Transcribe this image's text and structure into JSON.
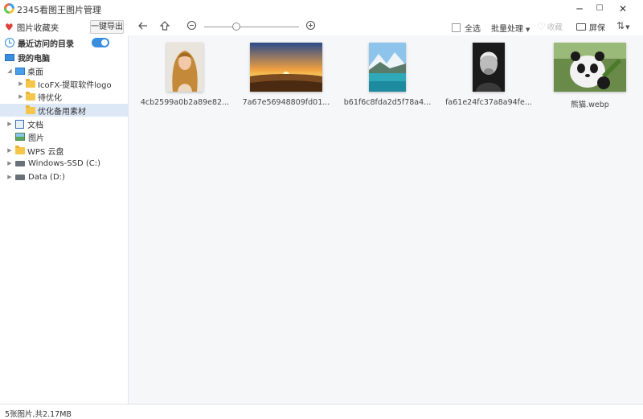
{
  "app": {
    "title": "2345看图王图片管理",
    "window_controls": [
      "─",
      "☐",
      "✕"
    ]
  },
  "toolbar": {
    "favorites_label": "图片收藏夹",
    "export_label": "一键导出",
    "select_all_label": "全选",
    "batch_label": "批量处理",
    "collect_label": "收藏",
    "screen_label": "屏保"
  },
  "sidebar": {
    "recent_label": "最近访问的目录",
    "recent_toggle_on": true,
    "my_pc_label": "我的电脑",
    "desktop_label": "桌面",
    "folders": [
      "IcoFX-提取软件logo",
      "待优化",
      "优化备用素材"
    ],
    "documents_label": "文档",
    "pictures_label": "图片",
    "wps_label": "WPS 云盘",
    "drive_c_label": "Windows-SSD (C:)",
    "drive_d_label": "Data (D:)"
  },
  "images": [
    {
      "name": "4cb2599a0b2a89e82...",
      "icon": "portrait-woman-photo"
    },
    {
      "name": "7a67e56948809fd01...",
      "icon": "sunset-landscape-photo"
    },
    {
      "name": "b61f6c8fda2d5f78a4...",
      "icon": "mountain-lake-photo"
    },
    {
      "name": "fa61e24fc37a8a94fe...",
      "icon": "old-man-portrait-photo"
    },
    {
      "name": "熊猫.webp",
      "icon": "panda-photo"
    }
  ],
  "status": {
    "text": "5张图片,共2.17MB"
  },
  "colors": {
    "accent": "#3a8ee0",
    "selected_row": "#dde8f6",
    "main_bg": "#f6f7f9"
  }
}
